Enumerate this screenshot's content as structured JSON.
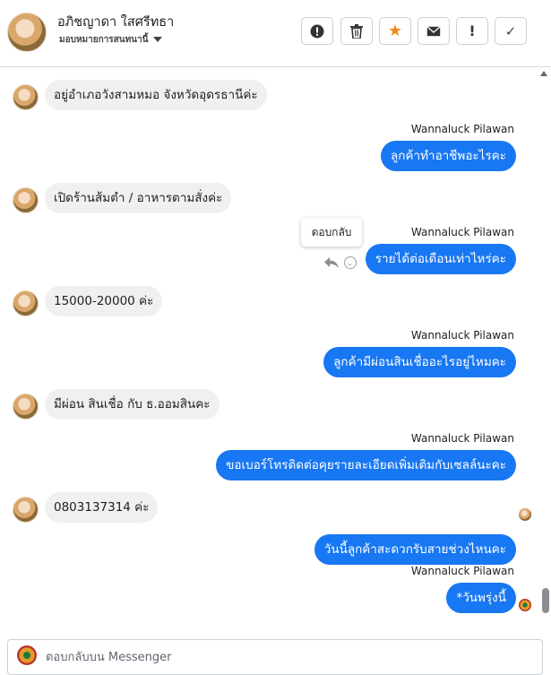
{
  "header": {
    "contact_name": "อภิชญาดา ใสศรีทธา",
    "assign_label": "มอบหมายการสนทนานี้",
    "actions": [
      {
        "name": "spam",
        "icon": "exclamation-circle-icon",
        "glyph": "⓿"
      },
      {
        "name": "delete",
        "icon": "trash-icon",
        "glyph": "🗑"
      },
      {
        "name": "star",
        "icon": "star-icon",
        "glyph": "★",
        "color": "#f2891d"
      },
      {
        "name": "mark-unread",
        "icon": "envelope-icon",
        "glyph": "✉"
      },
      {
        "name": "important",
        "icon": "exclamation-icon",
        "glyph": "!"
      },
      {
        "name": "done",
        "icon": "check-icon",
        "glyph": "✓"
      }
    ]
  },
  "messages": [
    {
      "from": "customer",
      "text": "อยู่อำเภอวังสามหมอ จังหวัดอุดรธานีค่ะ"
    },
    {
      "from": "agent",
      "sender": "Wannaluck Pilawan",
      "text": "ลูกค้าทำอาชีพอะไรคะ"
    },
    {
      "from": "customer",
      "text": "เปิดร้านส้มตำ / อาหารตามสั่งค่ะ"
    },
    {
      "from": "agent",
      "sender": "Wannaluck Pilawan",
      "text": "รายได้ต่อเดือนเท่าไหร่คะ"
    },
    {
      "from": "customer",
      "text": "15000-20000 ค่ะ"
    },
    {
      "from": "agent",
      "sender": "Wannaluck Pilawan",
      "text": "ลูกค้ามีผ่อนสินเชื่ออะไรอยู่ไหมคะ"
    },
    {
      "from": "customer",
      "text": "มีผ่อน สินเชื่อ กับ ธ.ออมสินคะ"
    },
    {
      "from": "agent",
      "sender": "Wannaluck Pilawan",
      "text": "ขอเบอร์โทรติดต่อคุยรายละเอียดเพิ่มเติมกับเซลล์นะคะ"
    },
    {
      "from": "customer",
      "text": "0803137314 ค่ะ"
    },
    {
      "from": "agent",
      "text": "วันนี้ลูกค้าสะดวกรับสายช่วงไหนคะ"
    },
    {
      "from": "agent",
      "sender": "Wannaluck Pilawan",
      "text": "*วันพรุ่งนี้"
    }
  ],
  "tooltip": {
    "reply": "ตอบกลับ"
  },
  "composer": {
    "placeholder": "ตอบกลับบน Messenger"
  },
  "colors": {
    "agent_bubble": "#1877f2",
    "customer_bubble": "#f0f0f0",
    "star": "#f2891d"
  }
}
